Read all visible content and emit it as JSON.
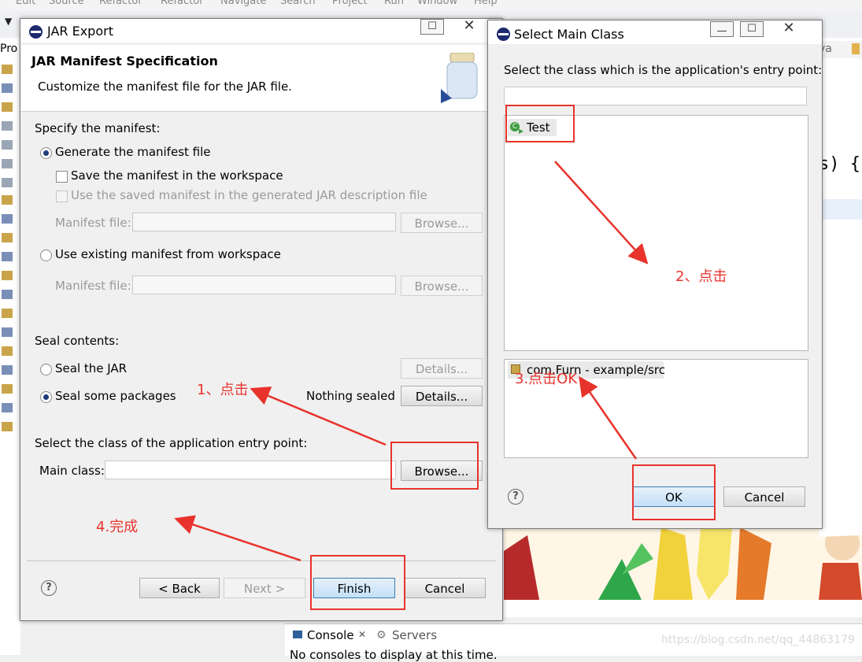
{
  "ide": {
    "menu": [
      "Edit",
      "Source",
      "Refactor",
      "Refactor",
      "Navigate",
      "Search",
      "Project",
      "Run",
      "Window",
      "Help"
    ],
    "left_label": "Pro",
    "editor_tab": "va",
    "code_fragment": "s) {",
    "console_tab": "Console",
    "servers_tab": "Servers",
    "console_text": "No consoles to display at this time.",
    "watermark": "https://blog.csdn.net/qq_44863179"
  },
  "jar_export": {
    "title": "JAR Export",
    "heading": "JAR Manifest Specification",
    "subheading": "Customize the manifest file for the JAR file.",
    "specify_label": "Specify the manifest:",
    "generate_option": "Generate the manifest file",
    "save_option": "Save the manifest in the workspace",
    "use_saved_option": "Use the saved manifest in the generated JAR description file",
    "manifest_file_label": "Manifest file:",
    "browse_label": "Browse...",
    "use_existing_option": "Use existing manifest from workspace",
    "seal_label": "Seal contents:",
    "seal_jar_option": "Seal the JAR",
    "seal_some_option": "Seal some packages",
    "nothing_sealed": "Nothing sealed",
    "details_label": "Details...",
    "entry_point_label": "Select the class of the application entry point:",
    "main_class_label": "Main class:",
    "back_label": "< Back",
    "next_label": "Next >",
    "finish_label": "Finish",
    "cancel_label": "Cancel"
  },
  "select_main": {
    "title": "Select Main Class",
    "prompt": "Select the class which is the application's entry point:",
    "class_item": "Test",
    "package_item": "com.Furn - example/src",
    "ok_label": "OK",
    "cancel_label": "Cancel"
  },
  "annotations": {
    "step1": "1、点击",
    "step2": "2、点击",
    "step3": "3.点击OK",
    "step4": "4.完成"
  },
  "colors": {
    "annotation_red": "#e8332c"
  }
}
